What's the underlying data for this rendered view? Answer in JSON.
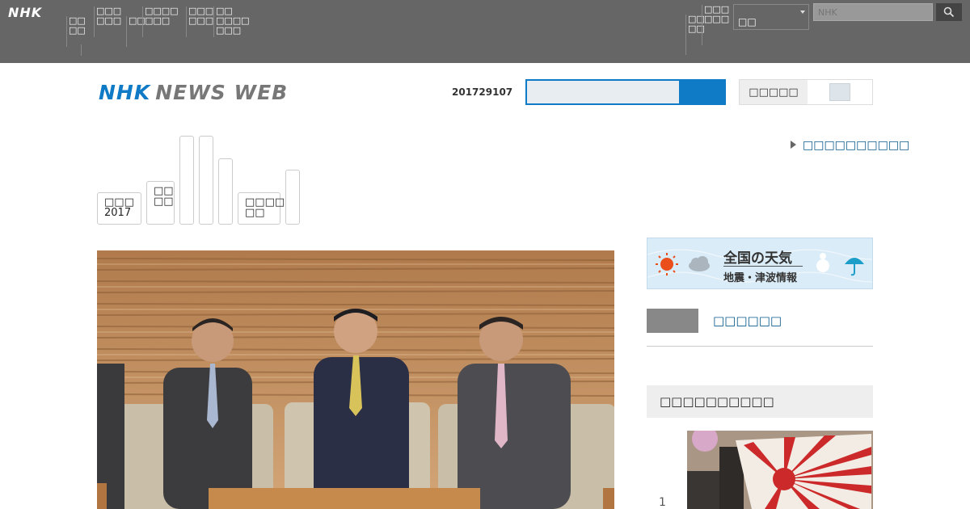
{
  "global_bar": {
    "logo": "NHK",
    "nav_items": [
      "□□\n□□",
      "□□□\n□□□",
      "□□",
      "□□□□\n□□□",
      "□□□\n□□□",
      "□□\n□□□□\n□□□"
    ],
    "right_items": [
      "□□\n□□",
      "□□□\n□□□"
    ],
    "region_select_value": "□□",
    "search_placeholder": "NHK"
  },
  "masthead": {
    "logo_part1": "NHK",
    "logo_part2": "NEWS WEB",
    "date": "201729107",
    "search_value": "",
    "toggle_label": "□□□□□"
  },
  "tabs": [
    {
      "label": "□□□\n2017"
    },
    {
      "label": "□□\n□□"
    },
    {
      "label": ""
    },
    {
      "label": ""
    },
    {
      "label": ""
    },
    {
      "label": "□□□□\n□□"
    },
    {
      "label": ""
    }
  ],
  "related_link": "□□□□□□□□□□",
  "sidebar": {
    "weather_title": "全国の天気",
    "weather_sub": "地震・津波情報",
    "link_text": "□□□□□□",
    "ranking_title": "□□□□□□□□□□",
    "ranking_first_number": "1"
  },
  "colors": {
    "brand_blue": "#0f7ac6",
    "global_bar": "#666666",
    "link": "#0a5a8c"
  }
}
